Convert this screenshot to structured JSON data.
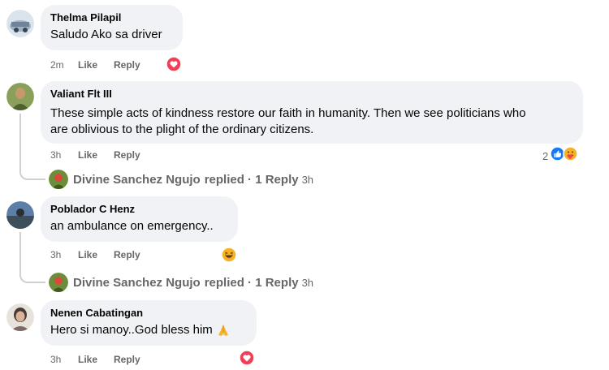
{
  "comments": [
    {
      "author": "Thelma Pilapil",
      "text": "Saludo Ako sa driver",
      "time": "2m",
      "like": "Like",
      "reply": "Reply"
    },
    {
      "author": "Valiant Flt III",
      "text_line1": "These simple acts of kindness restore our faith in humanity. Then we see politicians who",
      "text_line2": "are oblivious to the plight of the ordinary citizens.",
      "time": "3h",
      "like": "Like",
      "reply": "Reply",
      "reaction_count": "2",
      "replied": {
        "name": "Divine Sanchez Ngujo",
        "label": "replied · 1 Reply",
        "time": "3h"
      }
    },
    {
      "author": "Poblador C Henz",
      "text": "an ambulance on emergency..",
      "time": "3h",
      "like": "Like",
      "reply": "Reply",
      "replied": {
        "name": "Divine Sanchez Ngujo",
        "label": "replied · 1 Reply",
        "time": "3h"
      }
    },
    {
      "author": "Nenen Cabatingan",
      "text": "Hero si manoy..God bless him",
      "time": "3h",
      "like": "Like",
      "reply": "Reply"
    }
  ],
  "colors": {
    "bubble": "#f0f2f5",
    "meta": "#65676b",
    "like_blue": "#1877f2",
    "love_red": "#f33e58",
    "haha_yellow": "#f7b125"
  },
  "icons": [
    "love-icon",
    "like-icon",
    "care-icon",
    "haha-icon",
    "folded-hands-emoji"
  ]
}
